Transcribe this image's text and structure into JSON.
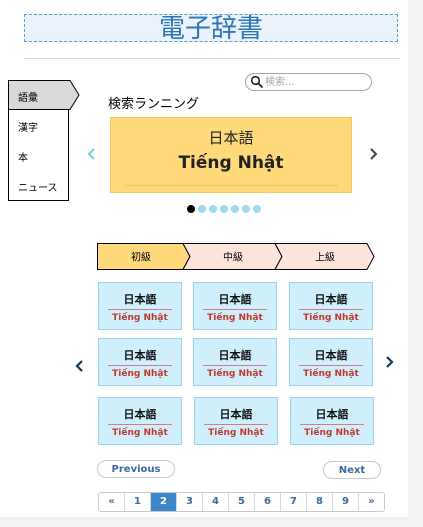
{
  "header": {
    "title": "電子辞書"
  },
  "search": {
    "placeholder": "検索..."
  },
  "side_menu": {
    "items": [
      "語彙",
      "漢字",
      "本",
      "ニュース"
    ],
    "active_index": 0
  },
  "ranking": {
    "label": "検索ランニング",
    "card": {
      "japanese": "日本語",
      "vietnamese": "Tiếng Nhật"
    },
    "slide_count": 7,
    "active_slide": 0
  },
  "levels": {
    "tabs": [
      "初級",
      "中級",
      "上級"
    ],
    "active_index": 0,
    "colors": {
      "active": "#ffd97a",
      "inactive": "#fde4dc"
    }
  },
  "words": [
    {
      "japanese": "日本語",
      "vietnamese": "Tiếng Nhật"
    },
    {
      "japanese": "日本語",
      "vietnamese": "Tiếng Nhật"
    },
    {
      "japanese": "日本語",
      "vietnamese": "Tiếng Nhật"
    },
    {
      "japanese": "日本語",
      "vietnamese": "Tiếng Nhật"
    },
    {
      "japanese": "日本語",
      "vietnamese": "Tiếng Nhật"
    },
    {
      "japanese": "日本語",
      "vietnamese": "Tiếng Nhật"
    },
    {
      "japanese": "日本語",
      "vietnamese": "Tiếng Nhật"
    },
    {
      "japanese": "日本語",
      "vietnamese": "Tiếng Nhật"
    },
    {
      "japanese": "日本語",
      "vietnamese": "Tiếng Nhật"
    }
  ],
  "buttons": {
    "previous": "Previous",
    "next": "Next"
  },
  "pagination": {
    "first": "«",
    "pages": [
      "1",
      "2",
      "3",
      "4",
      "5",
      "6",
      "7",
      "8",
      "9"
    ],
    "last": "»",
    "active_page": "2"
  },
  "colors": {
    "accent": "#2e75b6",
    "card": "#cfeffc",
    "ranking_card": "#ffd97a",
    "pager_active": "#3a86c8"
  }
}
